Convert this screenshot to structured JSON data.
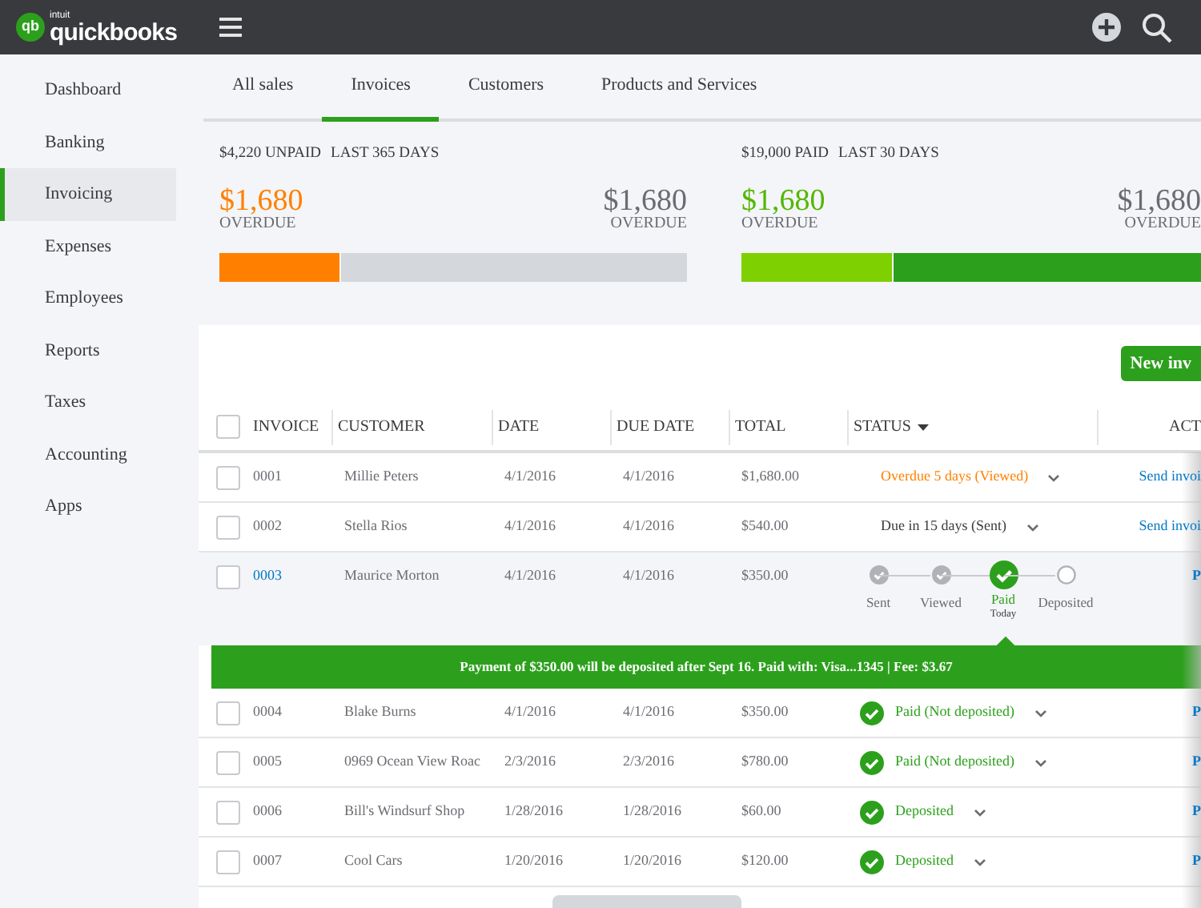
{
  "topbar": {
    "logo_small": "intuit",
    "logo": "quickbooks",
    "logo_badge": "qb"
  },
  "sidebar": {
    "items": [
      {
        "label": "Dashboard",
        "selected": false
      },
      {
        "label": "Banking",
        "selected": false
      },
      {
        "label": "Invoicing",
        "selected": true
      },
      {
        "label": "Expenses",
        "selected": false
      },
      {
        "label": "Employees",
        "selected": false
      },
      {
        "label": "Reports",
        "selected": false
      },
      {
        "label": "Taxes",
        "selected": false
      },
      {
        "label": "Accounting",
        "selected": false
      },
      {
        "label": "Apps",
        "selected": false
      }
    ]
  },
  "tabs": [
    {
      "label": "All sales",
      "selected": false
    },
    {
      "label": "Invoices",
      "selected": true
    },
    {
      "label": "Customers",
      "selected": false
    },
    {
      "label": "Products and Services",
      "selected": false
    }
  ],
  "summaries": [
    {
      "kind": "unpaid",
      "amount": "$4,220 UNPAID",
      "period": "LAST 365 DAYS",
      "left_value": "$1,680",
      "left_label": "OVERDUE",
      "right_value": "$1,680",
      "right_label": "OVERDUE",
      "level": 0.26
    },
    {
      "kind": "paid",
      "amount": "$19,000 PAID",
      "period": "LAST 30 DAYS",
      "left_value": "$1,680",
      "left_label": "OVERDUE",
      "right_value": "$1,680",
      "right_label": "OVERDUE",
      "level": 0.33
    }
  ],
  "new_button": "New inv",
  "select_all": {
    "checked": false
  },
  "table": {
    "columns": [
      "INVOICE",
      "CUSTOMER",
      "DATE",
      "DUE DATE",
      "TOTAL",
      "STATUS",
      "ACT"
    ],
    "rows": [
      {
        "checked": false,
        "expanded": false,
        "invoice": "0001",
        "customer": "Millie Peters",
        "date": "4/1/2016",
        "due_date": "4/1/2016",
        "total": "$1,680.00",
        "status": {
          "kind": "overdue",
          "label": "Overdue 5 days (Viewed)"
        },
        "action": "Send invoi"
      },
      {
        "checked": false,
        "expanded": false,
        "invoice": "0002",
        "customer": "Stella Rios",
        "date": "4/1/2016",
        "due_date": "4/1/2016",
        "total": "$540.00",
        "status": {
          "kind": "due",
          "label": "Due in 15 days (Sent)"
        },
        "action": "Send invoi"
      },
      {
        "checked": false,
        "expanded": true,
        "invoice": "0003",
        "customer": "Maurice Morton",
        "date": "4/1/2016",
        "due_date": "4/1/2016",
        "total": "$350.00",
        "status": {
          "kind": "stepper",
          "steps": [
            {
              "label": "Sent",
              "completed": true,
              "current": false
            },
            {
              "label": "Viewed",
              "completed": true,
              "current": false
            },
            {
              "label": "Paid",
              "sublabel": "Today",
              "completed": true,
              "current": true
            },
            {
              "label": "Deposited",
              "completed": false,
              "current": false
            }
          ]
        },
        "action": "P",
        "banner": "Payment of $350.00 will be deposited after Sept 16. Paid with: Visa...1345 | Fee: $3.67"
      },
      {
        "checked": false,
        "expanded": false,
        "invoice": "0004",
        "customer": "Blake Burns",
        "date": "4/1/2016",
        "due_date": "4/1/2016",
        "total": "$350.00",
        "status": {
          "kind": "paid",
          "label": "Paid (Not deposited)"
        },
        "action": "P"
      },
      {
        "checked": false,
        "expanded": false,
        "invoice": "0005",
        "customer": "0969 Ocean View Roac",
        "date": "2/3/2016",
        "due_date": "2/3/2016",
        "total": "$780.00",
        "status": {
          "kind": "paid",
          "label": "Paid (Not deposited)"
        },
        "action": "P"
      },
      {
        "checked": false,
        "expanded": false,
        "invoice": "0006",
        "customer": "Bill's Windsurf Shop",
        "date": "1/28/2016",
        "due_date": "1/28/2016",
        "total": "$60.00",
        "status": {
          "kind": "paid",
          "label": "Deposited"
        },
        "action": "P"
      },
      {
        "checked": false,
        "expanded": false,
        "invoice": "0007",
        "customer": "Cool Cars",
        "date": "1/20/2016",
        "due_date": "1/20/2016",
        "total": "$120.00",
        "status": {
          "kind": "paid",
          "label": "Deposited"
        },
        "action": "P"
      }
    ]
  }
}
